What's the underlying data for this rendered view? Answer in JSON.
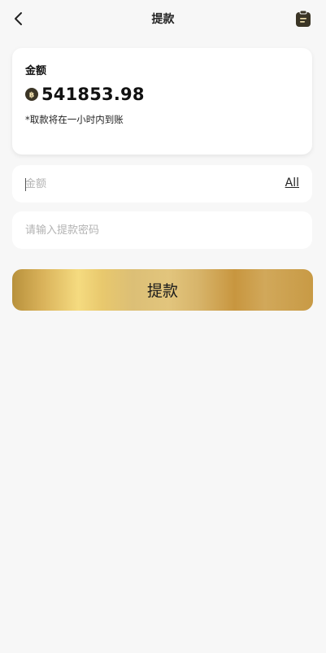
{
  "header": {
    "title": "提款",
    "back_icon": "chevron-left-icon",
    "record_icon": "clipboard-icon"
  },
  "balance_card": {
    "label": "金额",
    "coin_icon": "baht-coin-icon",
    "value": "541853.98",
    "note": "*取款将在一小时内到账"
  },
  "amount_field": {
    "placeholder": "金额",
    "value": "",
    "all_label": "All"
  },
  "password_field": {
    "placeholder": "请输入提款密码",
    "value": ""
  },
  "submit": {
    "label": "提款"
  },
  "colors": {
    "background": "#f7f7f7",
    "card": "#ffffff",
    "gold_light": "#f5db80",
    "gold_dark": "#c8963f"
  }
}
